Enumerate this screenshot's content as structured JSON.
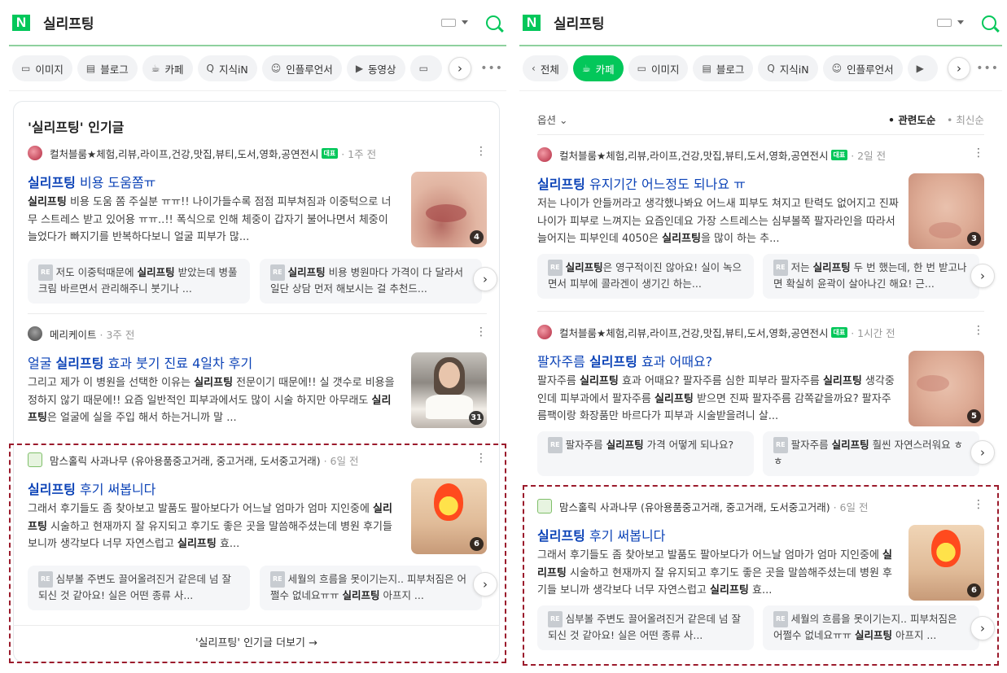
{
  "query": "실리프팅",
  "logo": "N",
  "left": {
    "tabs": [
      {
        "icon": "image-icon",
        "glyph": "▭",
        "label": "이미지"
      },
      {
        "icon": "blog-icon",
        "glyph": "▤",
        "label": "블로그"
      },
      {
        "icon": "cafe-icon",
        "glyph": "☕",
        "label": "카페"
      },
      {
        "icon": "kin-icon",
        "glyph": "Q",
        "label": "지식iN"
      },
      {
        "icon": "person-icon",
        "glyph": "☺",
        "label": "인플루언서"
      },
      {
        "icon": "video-icon",
        "glyph": "▶",
        "label": "동영상"
      },
      {
        "icon": "more-tab-icon",
        "glyph": "▭",
        "label": ""
      }
    ],
    "section_title": "'실리프팅' 인기글",
    "more_link": "'실리프팅' 인기글 더보기 →",
    "posts": [
      {
        "author": "컬처블룸★체험,리뷰,라이프,건강,맛집,뷰티,도서,영화,공연전시",
        "badge": "대표",
        "time": "· 1주 전",
        "title": "실리프팅 비용 도움쫌ㅠ",
        "snippet": "실리프팅 비용 도움 쫌 주실분 ㅠㅠ!! 나이가들수록 점점 피부쳐짐과 이중턱으로 너무 스트레스 받고 있어용 ㅠㅠ..!! 폭식으로 인해 체중이 갑자기 불어나면서 체중이 늘었다가 빠지기를 반복하다보니 얼굴 피부가 많...",
        "count": "4",
        "replies": [
          "저도 이중턱때문에 실리프팅 받았는데 병풀크림 바르면서 관리해주니 붓기나 ...",
          "실리프팅 비용 병원마다 가격이 다 달라서 일단 상담 먼저 해보시는 걸 추천드..."
        ]
      },
      {
        "author": "메리케이트",
        "time": "· 3주 전",
        "title": "얼굴 실리프팅 효과 붓기 진료 4일차 후기",
        "snippet": "그리고 제가 이 병원을 선택한 이유는 실리프팅 전문이기 때문에!! 실 갯수로 비용을 정하지 않기 때문에!! 요즘 일반적인 피부과에서도 많이 시술 하지만 아무래도 실리프팅은 얼굴에 실을 주입 해서 하는거니까 말 ...",
        "count": "31"
      },
      {
        "author": "맘스홀릭 사과나무 (유아용품중고거래, 중고거래, 도서중고거래)",
        "time": "· 6일 전",
        "title": "실리프팅 후기 써봅니다",
        "snippet": "그래서 후기들도 좀 찾아보고 발품도 팔아보다가 어느날 엄마가 엄마 지인중에 실리프팅 시술하고 현재까지 잘 유지되고 후기도 좋은 곳을 말씀해주셨는데 병원 후기들 보니까 생각보다 너무 자연스럽고 실리프팅 효...",
        "count": "6",
        "replies": [
          "심부볼 주변도 끌어올려진거 같은데 넘 잘되신 것 같아요! 실은 어떤 종류 사...",
          "세월의 흐름을 못이기는지.. 피부처짐은 어쩔수 없네요ㅠㅠ 실리프팅 아프지 ..."
        ]
      }
    ]
  },
  "right": {
    "tabs": [
      {
        "icon": "back-icon",
        "glyph": "‹",
        "label": "전체"
      },
      {
        "icon": "cafe-icon",
        "glyph": "☕",
        "label": "카페",
        "active": true
      },
      {
        "icon": "image-icon",
        "glyph": "▭",
        "label": "이미지"
      },
      {
        "icon": "blog-icon",
        "glyph": "▤",
        "label": "블로그"
      },
      {
        "icon": "kin-icon",
        "glyph": "Q",
        "label": "지식iN"
      },
      {
        "icon": "person-icon",
        "glyph": "☺",
        "label": "인플루언서"
      },
      {
        "icon": "video-icon",
        "glyph": "▶",
        "label": ""
      }
    ],
    "options_label": "옵션",
    "sort_relevance": "• 관련도순",
    "sort_latest": "• 최신순",
    "posts": [
      {
        "author": "컬처블룸★체험,리뷰,라이프,건강,맛집,뷰티,도서,영화,공연전시",
        "badge": "대표",
        "time": "· 2일 전",
        "title": "실리프팅 유지기간 어느정도 되나요 ㅠ",
        "snippet": "저는 나이가 안들꺼라고 생각했나봐요 어느새 피부도 쳐지고 탄력도 없어지고 진짜 나이가 피부로 느껴지는 요즘인데요 가장 스트레스는 심부볼쪽 팔자라인을 따라서 늘어지는 피부인데 4050은 실리프팅을 많이 하는 추...",
        "count": "3",
        "replies": [
          "실리프팅은 영구적이진 않아요! 실이 녹으면서 피부에 콜라겐이 생기긴 하는...",
          "저는 실리프팅 두 번 했는데, 한 번 받고나면 확실히 윤곽이 살아나긴 해요! 근..."
        ]
      },
      {
        "author": "컬처블룸★체험,리뷰,라이프,건강,맛집,뷰티,도서,영화,공연전시",
        "badge": "대표",
        "time": "· 1시간 전",
        "title": "팔자주름 실리프팅 효과 어때요?",
        "snippet": "팔자주름 실리프팅 효과 어때요? 팔자주름 심한 피부라 팔자주름 실리프팅 생각중인데 피부과에서 팔자주름 실리프팅 받으면 진짜 팔자주름 감쪽같을까요? 팔자주름팩이랑 화장품만 바르다가 피부과 시술받을려니 살...",
        "count": "5",
        "replies": [
          "팔자주름 실리프팅 가격 어떻게 되나요?",
          "팔자주름 실리프팅 훨씬 자연스러워요 ㅎㅎ"
        ]
      },
      {
        "author": "맘스홀릭 사과나무 (유아용품중고거래, 중고거래, 도서중고거래)",
        "time": "· 6일 전",
        "title": "실리프팅 후기 써봅니다",
        "snippet": "그래서 후기들도 좀 찾아보고 발품도 팔아보다가 어느날 엄마가 엄마 지인중에 실리프팅 시술하고 현재까지 잘 유지되고 후기도 좋은 곳을 말씀해주셨는데 병원 후기들 보니까 생각보다 너무 자연스럽고 실리프팅 효...",
        "count": "6",
        "replies": [
          "심부볼 주변도 끌어올려진거 같은데 넘 잘되신 것 같아요! 실은 어떤 종류 사...",
          "세월의 흐름을 못이기는지.. 피부처짐은 어쩔수 없네요ㅠㅠ 실리프팅 아프지 ..."
        ]
      }
    ]
  },
  "ui": {
    "next": "›",
    "kebab": "⋮",
    "more_dots": "•••",
    "re": "RE"
  },
  "colors": {
    "brand": "#03c75a",
    "link": "#0c43b7",
    "highlight_border": "#9b1b2c"
  }
}
